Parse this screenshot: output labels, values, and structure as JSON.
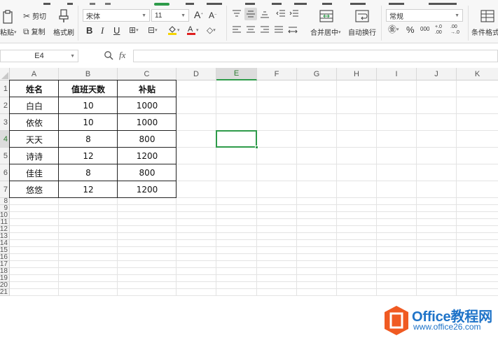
{
  "ribbon": {
    "paste_label": "粘贴",
    "cut_label": "剪切",
    "copy_label": "复制",
    "format_painter_label": "格式刷",
    "font_name": "宋体",
    "font_size": "11",
    "bold_label": "B",
    "italic_label": "I",
    "underline_label": "U",
    "grow_font_label": "A",
    "shrink_font_label": "A",
    "merge_center_label": "合并居中",
    "wrap_text_label": "自动换行",
    "number_format": "常规",
    "percent_label": "%",
    "thousands_label": "000",
    "inc_decimal_label": "+.0 .00",
    "dec_decimal_label": ".00 →.0",
    "conditional_format_label": "条件格式",
    "accent_green": "#2e9b4a"
  },
  "formula_bar": {
    "name_box": "E4",
    "fx_label": "fx",
    "formula_value": ""
  },
  "sheet": {
    "columns": [
      "A",
      "B",
      "C",
      "D",
      "E",
      "F",
      "G",
      "H",
      "I",
      "J",
      "K"
    ],
    "rows": [
      "1",
      "2",
      "3",
      "4",
      "5",
      "6",
      "7",
      "8",
      "9",
      "10",
      "11",
      "12",
      "13",
      "14",
      "15",
      "16",
      "17",
      "18",
      "19",
      "20",
      "21"
    ],
    "selected_column": "E",
    "selected_row": "4",
    "table": {
      "headers": [
        "姓名",
        "值班天数",
        "补贴"
      ],
      "rows": [
        [
          "白白",
          "10",
          "1000"
        ],
        [
          "依依",
          "10",
          "1000"
        ],
        [
          "天天",
          "8",
          "800"
        ],
        [
          "诗诗",
          "12",
          "1200"
        ],
        [
          "佳佳",
          "8",
          "800"
        ],
        [
          "悠悠",
          "12",
          "1200"
        ]
      ]
    }
  },
  "watermark": {
    "brand": "Office教程网",
    "url": "www.office26.com",
    "colors": {
      "blue": "#1e73c8",
      "orange": "#f05a22"
    }
  }
}
